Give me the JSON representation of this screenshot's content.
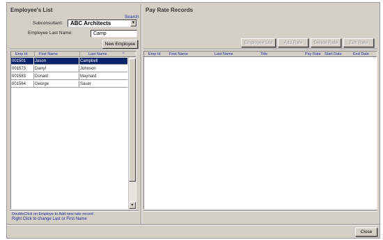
{
  "left_panel": {
    "title": "Employee's List",
    "search_label": "Search",
    "subconsultant_label": "Subconsultant:",
    "subconsultant_value": "ABC Architects",
    "last_name_label": "Employee Last Name:",
    "last_name_value": "Camp",
    "new_employee_button": "New Employee",
    "columns": [
      "Emp Id",
      "First Name",
      "Last Name"
    ],
    "rows": [
      {
        "id": "001501",
        "first": "Jason",
        "last": "Campbell",
        "selected": true
      },
      {
        "id": "001573",
        "first": "Darryl",
        "last": "Johnson",
        "selected": false
      },
      {
        "id": "001583",
        "first": "Donald",
        "last": "Maynard",
        "selected": false
      },
      {
        "id": "001564",
        "first": "George",
        "last": "Sauer",
        "selected": false
      }
    ],
    "hint_double_click": "DoubleClick on Employe to Add new rate record",
    "hint_right_click": "Right Click to change Last or First Name"
  },
  "right_panel": {
    "title": "Pay Rate Records",
    "buttons": {
      "employee_list": "Employee List",
      "add_rate": "Add Rate",
      "delete_rate": "Delete Rate",
      "edit_rate": "Edit Rate"
    },
    "columns": [
      "Emp Id",
      "First Name",
      "Last Name",
      "Title",
      "Pay Rate",
      "Start Date",
      "End Date"
    ]
  },
  "footer": {
    "close_button": "Close"
  }
}
